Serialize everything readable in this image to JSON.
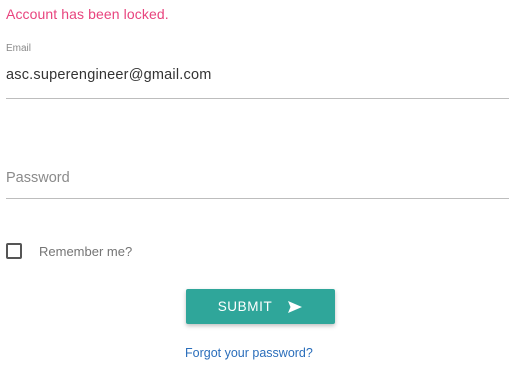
{
  "alert": {
    "message": "Account has been locked.",
    "color": "#e8447e"
  },
  "email": {
    "label": "Email",
    "value": "asc.superengineer@gmail.com"
  },
  "password": {
    "placeholder": "Password",
    "value": ""
  },
  "remember": {
    "label": "Remember me?",
    "checked": false
  },
  "submit": {
    "label": "SUBMIT",
    "icon": "send-icon",
    "color": "#2fa69a"
  },
  "forgot": {
    "label": "Forgot your password?",
    "color": "#2a6ebb"
  }
}
